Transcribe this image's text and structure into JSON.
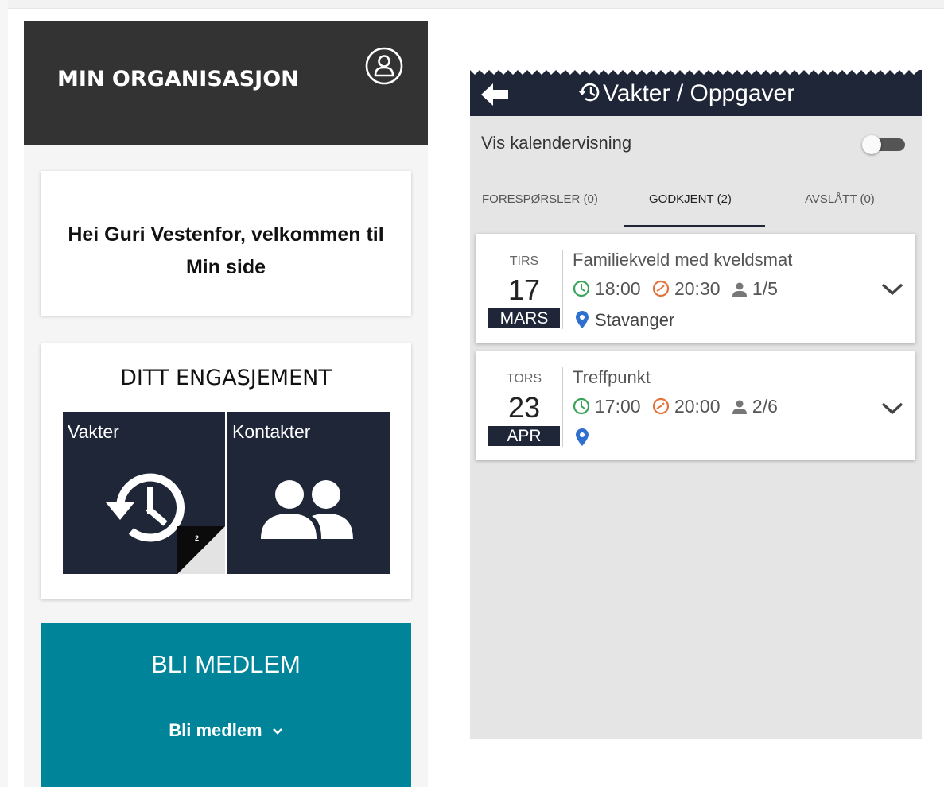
{
  "left_app": {
    "org_title": "MIN ORGANISASJON",
    "welcome": "Hei Guri Vestenfor, velkommen til Min side",
    "engagement": {
      "title": "DITT ENGASJEMENT",
      "tiles": [
        {
          "label": "Vakter",
          "icon": "history-clock-icon",
          "badge": "2"
        },
        {
          "label": "Kontakter",
          "icon": "people-icon"
        }
      ]
    },
    "membership": {
      "title": "BLI MEDLEM",
      "link": "Bli medlem"
    }
  },
  "right_app": {
    "title": "Vakter / Oppgaver",
    "calendar_toggle_label": "Vis kalendervisning",
    "calendar_toggle_on": false,
    "tabs": [
      {
        "label": "FORESPØRSLER (0)",
        "active": false
      },
      {
        "label": "GODKJENT (2)",
        "active": true
      },
      {
        "label": "AVSLÅTT (0)",
        "active": false
      }
    ],
    "events": [
      {
        "dow": "TIRS",
        "day": "17",
        "month": "MARS",
        "title": "Familiekveld med kveldsmat",
        "start": "18:00",
        "end": "20:30",
        "participants": "1/5",
        "location": "Stavanger"
      },
      {
        "dow": "TORS",
        "day": "23",
        "month": "APR",
        "title": "Treffpunkt",
        "start": "17:00",
        "end": "20:00",
        "participants": "2/6",
        "location": ""
      }
    ]
  },
  "colors": {
    "header_dark": "#333333",
    "navy": "#1e2638",
    "teal": "#00849a",
    "green_icon": "#3aa35a",
    "orange_icon": "#e2733a",
    "location_blue": "#2e6fd0",
    "screen_bg": "#e5e5e5"
  }
}
